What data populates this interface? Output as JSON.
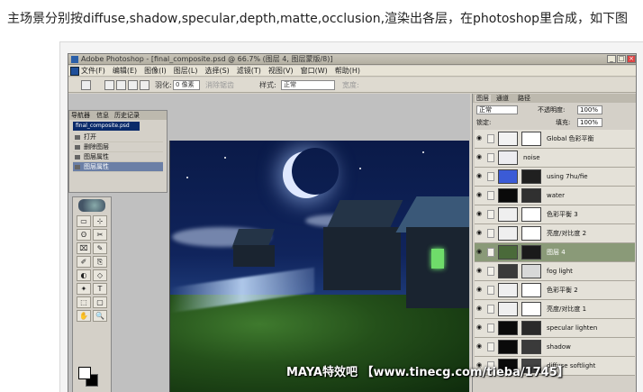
{
  "caption": "主场景分别按diffuse,shadow,specular,depth,matte,occlusion,渲染出各层，在photoshop里合成，如下图",
  "window": {
    "title": "Adobe Photoshop - [final_composite.psd @ 66.7% (图层 4, 图层蒙版/8)]",
    "buttons": [
      "_",
      "□",
      "×"
    ]
  },
  "menu": [
    "文件(F)",
    "编辑(E)",
    "图像(I)",
    "图层(L)",
    "选择(S)",
    "滤镜(T)",
    "视图(V)",
    "窗口(W)",
    "帮助(H)"
  ],
  "options": {
    "feather_label": "羽化:",
    "feather_value": "0 像素",
    "antialias_label": "消除锯齿",
    "style_label": "样式:",
    "style_value": "正常",
    "width_label": "宽度:"
  },
  "history_panel": {
    "tabs": [
      "导航器",
      "信息",
      "历史记录"
    ],
    "file": "final_composite.psd",
    "items": [
      {
        "label": "打开",
        "selected": false
      },
      {
        "label": "删除图层",
        "selected": false
      },
      {
        "label": "图层属性",
        "selected": false
      },
      {
        "label": "图层属性",
        "selected": true
      }
    ]
  },
  "toolbox": {
    "tools": [
      "▭",
      "⊹",
      "ʘ",
      "✂",
      "⌧",
      "✎",
      "✐",
      "⎘",
      "◐",
      "◇",
      "✦",
      "T",
      "⬚",
      "▢",
      "✋",
      "🔍"
    ]
  },
  "layers_panel": {
    "tabs": [
      "图层",
      "通道",
      "路径"
    ],
    "blend_mode": "正常",
    "opacity_label": "不透明度:",
    "opacity_value": "100%",
    "lock_label": "锁定:",
    "fill_label": "填充:",
    "fill_value": "100%",
    "layers": [
      {
        "name": "Global 色彩平衡",
        "thumb1": "#f2f2f2",
        "thumb2": "#ffffff",
        "selected": false,
        "wide": false
      },
      {
        "name": "noise",
        "thumb1": "#ececf0",
        "thumb2": "",
        "selected": false,
        "wide": true
      },
      {
        "name": "using 7hu/fie",
        "thumb1": "#3b5bd6",
        "thumb2": "#202020",
        "selected": false,
        "wide": false
      },
      {
        "name": "water",
        "thumb1": "#0a0a0a",
        "thumb2": "#303030",
        "selected": false,
        "wide": false
      },
      {
        "name": "色彩平衡 3",
        "thumb1": "#efefef",
        "thumb2": "#ffffff",
        "selected": false,
        "wide": false
      },
      {
        "name": "亮度/对比度 2",
        "thumb1": "#efefef",
        "thumb2": "#ffffff",
        "selected": false,
        "wide": false
      },
      {
        "name": "图层 4",
        "thumb1": "#4a6a3a",
        "thumb2": "#1a1a1a",
        "selected": true,
        "wide": false
      },
      {
        "name": "fog light",
        "thumb1": "#3a3a3a",
        "thumb2": "#d8d8d8",
        "selected": false,
        "wide": false
      },
      {
        "name": "色彩平衡 2",
        "thumb1": "#efefef",
        "thumb2": "#ffffff",
        "selected": false,
        "wide": false
      },
      {
        "name": "亮度/对比度 1",
        "thumb1": "#efefef",
        "thumb2": "#ffffff",
        "selected": false,
        "wide": false
      },
      {
        "name": "specular lighten",
        "thumb1": "#0a0a0a",
        "thumb2": "#2a2a2a",
        "selected": false,
        "wide": false
      },
      {
        "name": "shadow",
        "thumb1": "#0a0a0a",
        "thumb2": "#3a3a3a",
        "selected": false,
        "wide": false
      },
      {
        "name": "diffuse softlight",
        "thumb1": "#0a0a0a",
        "thumb2": "#444444",
        "selected": false,
        "wide": false
      }
    ]
  },
  "watermark": "MAYA特效吧 【www.tinecg.com/tieba/1745】"
}
